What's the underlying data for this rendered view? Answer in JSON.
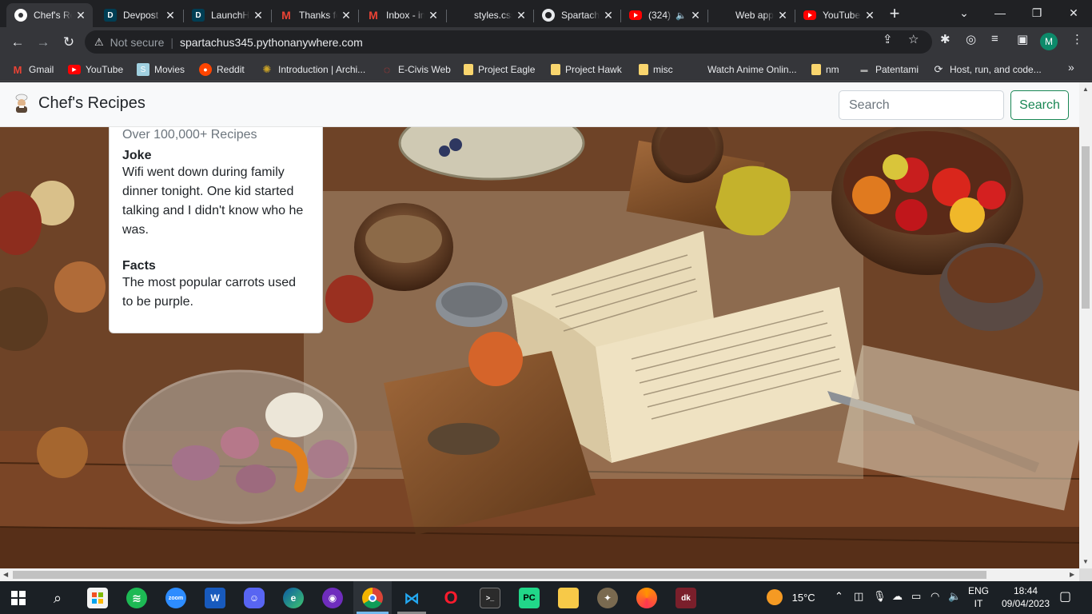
{
  "browser": {
    "tabs": [
      {
        "title": "Chef's Recipes",
        "active": true
      },
      {
        "title": "Devpost"
      },
      {
        "title": "LaunchHacks"
      },
      {
        "title": "Thanks for"
      },
      {
        "title": "Inbox - in"
      },
      {
        "title": "styles.css"
      },
      {
        "title": "Spartachus"
      },
      {
        "title": "(324)"
      },
      {
        "title": "Web app"
      },
      {
        "title": "YouTube"
      }
    ],
    "security_label": "Not secure",
    "url": "spartachus345.pythonanywhere.com",
    "profile_initial": "M",
    "bookmarks": [
      {
        "label": "Gmail"
      },
      {
        "label": "YouTube"
      },
      {
        "label": "Movies"
      },
      {
        "label": "Reddit"
      },
      {
        "label": "Introduction | Archi..."
      },
      {
        "label": "E-Civis Web"
      },
      {
        "label": "Project Eagle"
      },
      {
        "label": "Project Hawk"
      },
      {
        "label": "misc"
      },
      {
        "label": "Watch Anime Onlin..."
      },
      {
        "label": "nm"
      },
      {
        "label": "Patentami"
      },
      {
        "label": "Host, run, and code..."
      }
    ]
  },
  "page": {
    "brand": "Chef's Recipes",
    "search_placeholder": "Search",
    "search_button": "Search",
    "card": {
      "count": "Over 100,000+ Recipes",
      "joke_heading": "Joke",
      "joke_text": "Wifi went down during family dinner tonight. One kid started talking and I didn't know who he was.",
      "facts_heading": "Facts",
      "facts_text": "The most popular carrots used to be purple."
    },
    "accent_color": "#198754"
  },
  "taskbar": {
    "weather": "15°C",
    "lang_line1": "ENG",
    "lang_line2": "IT",
    "time": "18:44",
    "date": "09/04/2023"
  }
}
